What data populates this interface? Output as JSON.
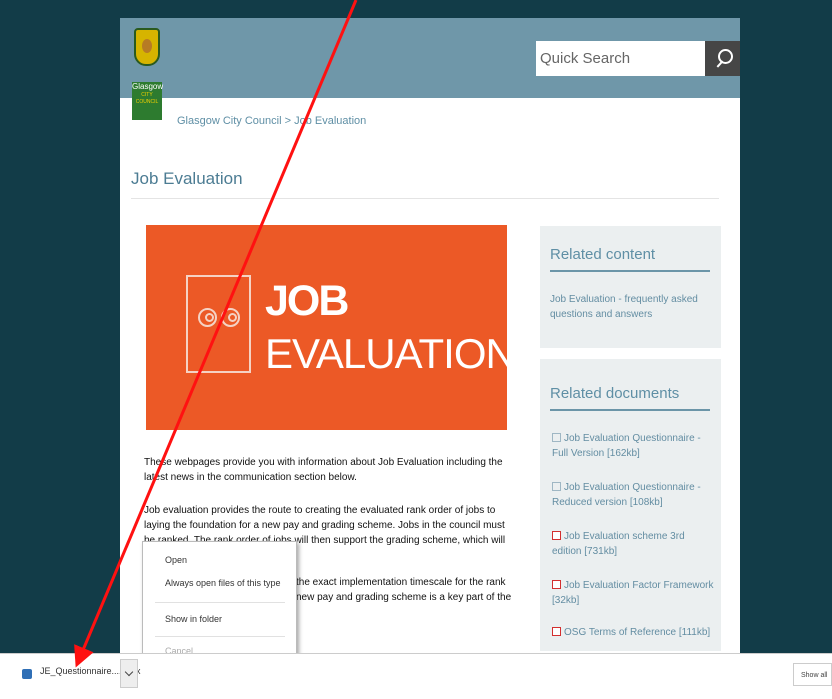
{
  "header": {
    "logo_text": "Glasgow",
    "logo_small": "CITY COUNCIL",
    "search_placeholder": "Quick Search"
  },
  "breadcrumb": {
    "home": "Glasgow City Council",
    "sep": ">",
    "current": "Job Evaluation"
  },
  "page": {
    "title": "Job Evaluation",
    "banner_job": "JOB",
    "banner_evaluation": "EVALUATION",
    "para1": "These webpages provide you with information about Job Evaluation including the latest news in the communication section below.",
    "para2": "Job evaluation provides the route to creating the evaluated rank order of jobs to laying the foundation for a new pay and grading scheme. Jobs in the council must be ranked. The rank order of jobs will then support the grading scheme, which will be a separate project.",
    "para3": "the exact implementation timescale for the rank new pay and grading scheme is a key part of the"
  },
  "sidebar": {
    "related_content": {
      "heading": "Related content",
      "link": "Job Evaluation - frequently asked questions and answers"
    },
    "related_documents": {
      "heading": "Related documents",
      "items": [
        "Job Evaluation Questionnaire - Full Version [162kb]",
        "Job Evaluation Questionnaire - Reduced version [108kb]",
        "Job Evaluation scheme 3rd edition [731kb]",
        "Job Evaluation Factor Framework [32kb]",
        "OSG Terms of Reference [111kb]"
      ]
    }
  },
  "context_menu": {
    "items": [
      "Open",
      "Always open files of this type",
      "Show in folder",
      "Cancel"
    ]
  },
  "download_bar": {
    "file_name": "JE_Questionnaire....docx",
    "show_all": "Show all"
  }
}
